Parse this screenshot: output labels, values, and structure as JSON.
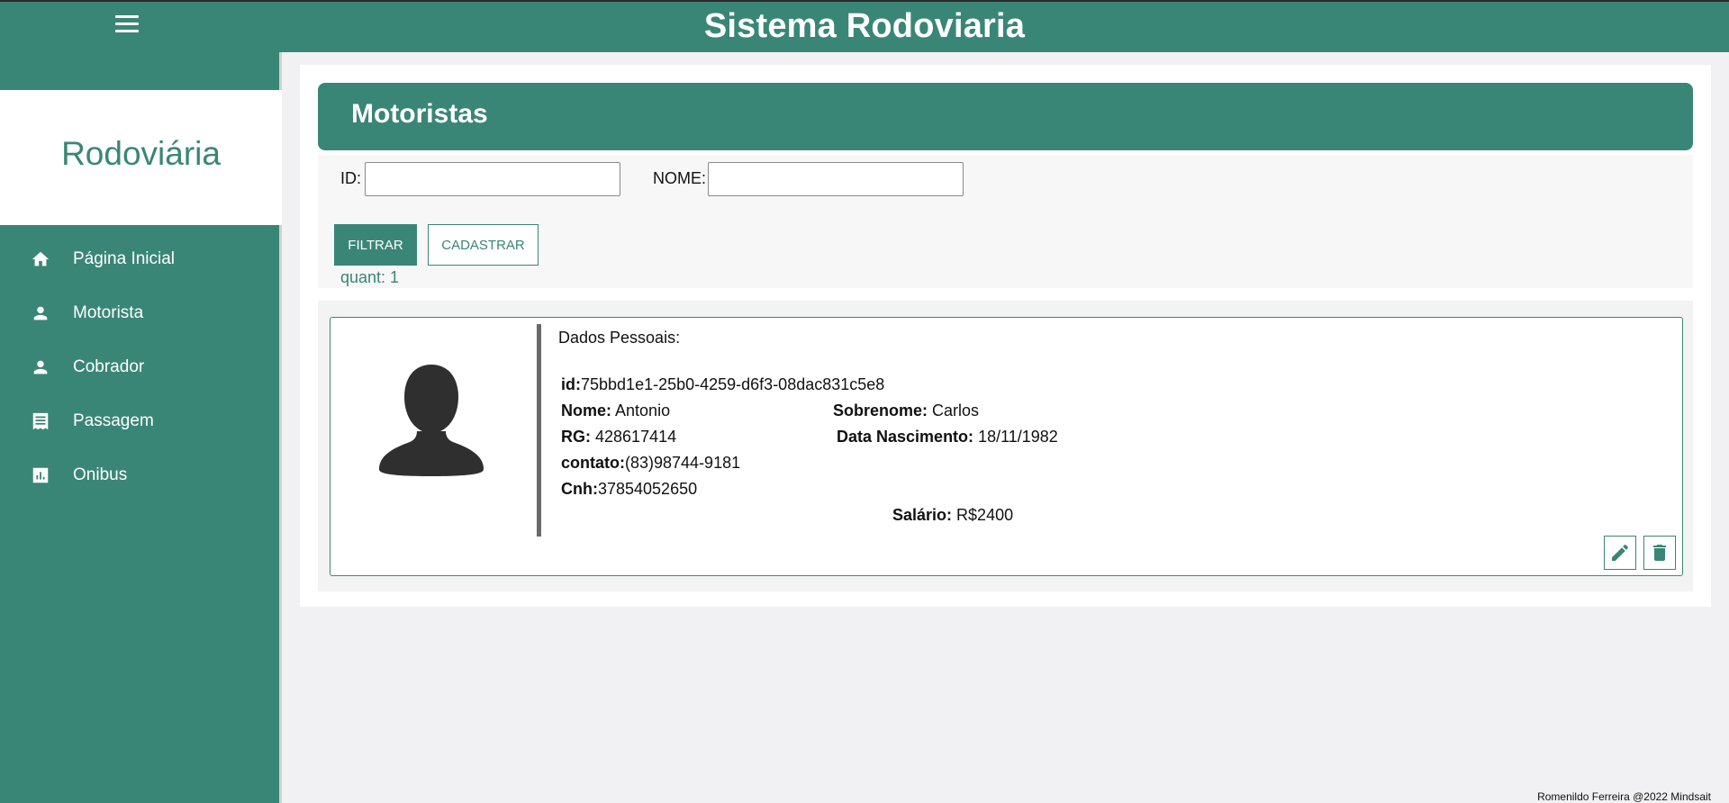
{
  "header": {
    "title": "Sistema Rodoviaria",
    "menu_icon": "menu-icon"
  },
  "sidebar": {
    "brand": "Rodoviária",
    "items": [
      {
        "label": "Página Inicial",
        "icon": "home-icon"
      },
      {
        "label": "Motorista",
        "icon": "person-icon"
      },
      {
        "label": "Cobrador",
        "icon": "person-icon"
      },
      {
        "label": "Passagem",
        "icon": "receipt-icon"
      },
      {
        "label": "Onibus",
        "icon": "chart-icon"
      }
    ]
  },
  "main": {
    "title": "Motoristas",
    "filters": {
      "id_label": "ID:",
      "id_value": "",
      "nome_label": "NOME:",
      "nome_value": ""
    },
    "buttons": {
      "filtrar": "FILTRAR",
      "cadastrar": "CADASTRAR"
    },
    "quant": "quant: 1",
    "records": [
      {
        "section_title": "Dados Pessoais:",
        "id_label": "id:",
        "id": "75bbd1e1-25b0-4259-d6f3-08dac831c5e8",
        "nome_label": "Nome:",
        "nome": "Antonio",
        "sobrenome_label": "Sobrenome:",
        "sobrenome": "Carlos",
        "rg_label": "RG:",
        "rg": "428617414",
        "nascimento_label": "Data Nascimento:",
        "nascimento": "18/11/1982",
        "contato_label": "contato:",
        "contato": "(83)98744-9181",
        "cnh_label": "Cnh:",
        "cnh": "37854052650",
        "salario_label": "Salário:",
        "salario": "R$2400",
        "edit_icon": "pencil-icon",
        "delete_icon": "trash-icon"
      }
    ]
  },
  "footer": {
    "text": "Romenildo Ferreira @2022 Mindsait"
  },
  "colors": {
    "primary": "#3a8676",
    "background": "#f1f1f3"
  }
}
